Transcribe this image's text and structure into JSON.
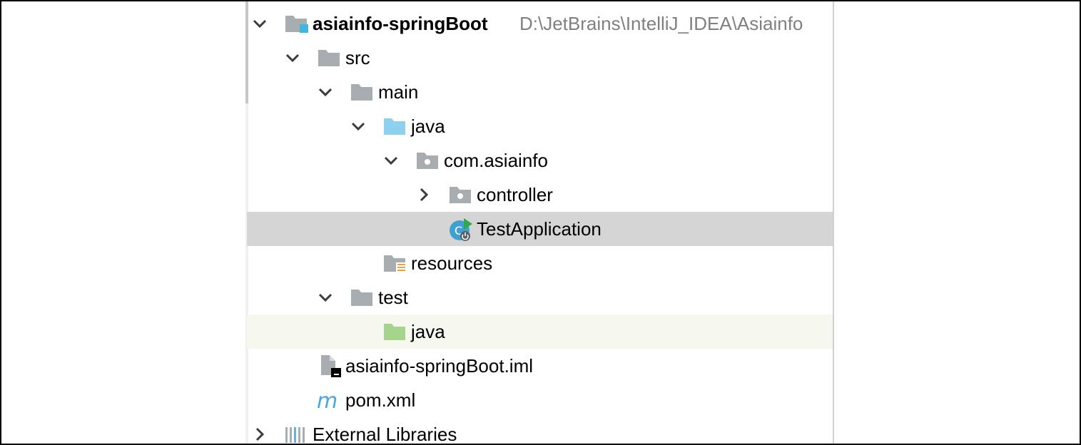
{
  "tree": {
    "root": {
      "name": "asiainfo-springBoot",
      "path": "D:\\JetBrains\\IntelliJ_IDEA\\Asiainfo"
    },
    "src": "src",
    "main": "main",
    "main_java": "java",
    "package": "com.asiainfo",
    "controller": "controller",
    "app_class": "TestApplication",
    "resources": "resources",
    "test": "test",
    "test_java": "java",
    "iml_file": "asiainfo-springBoot.iml",
    "pom_file": "pom.xml",
    "external_libraries": "External Libraries"
  },
  "colors": {
    "folder_gray": "#a8adb2",
    "source_blue": "#8fd0ee",
    "test_green": "#a7d48c",
    "module_accent": "#40b6e0",
    "maven_blue": "#4aa8e0",
    "selection": "#d5d5d5",
    "hover": "#f6f7ee"
  },
  "icons": {
    "expanded": "chevron-down-icon",
    "collapsed": "chevron-right-icon",
    "folder": "folder-icon",
    "package": "package-icon",
    "module": "module-icon",
    "spring_boot_app": "spring-boot-app-icon",
    "resources": "resources-folder-icon",
    "test_sources": "test-sources-folder-icon",
    "source": "source-folder-icon",
    "iml": "iml-file-icon",
    "maven": "maven-m-icon",
    "libraries": "libraries-icon"
  }
}
